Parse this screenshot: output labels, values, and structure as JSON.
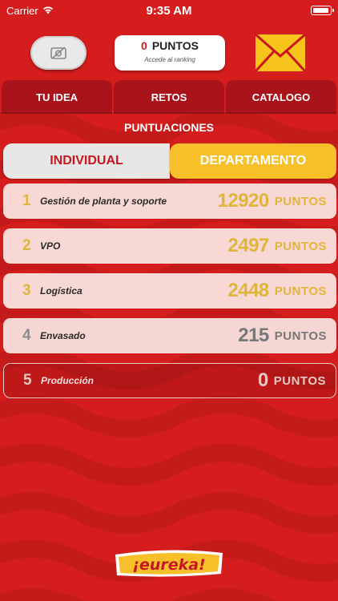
{
  "status_bar": {
    "carrier": "Carrier",
    "time": "9:35 AM"
  },
  "header": {
    "points_value": "0",
    "points_label": "PUNTOS",
    "points_subtitle": "Accede al ranking"
  },
  "nav": {
    "tabs": [
      "TU IDEA",
      "RETOS",
      "CATALOGO"
    ]
  },
  "section_title": "PUNTUACIONES",
  "segment": {
    "individual": "INDIVIDUAL",
    "department": "DEPARTAMENTO",
    "selected": "DEPARTAMENTO"
  },
  "ranking": [
    {
      "rank": "1",
      "name": "Gestión de planta y soporte",
      "score": "12920",
      "unit": "PUNTOS"
    },
    {
      "rank": "2",
      "name": "VPO",
      "score": "2497",
      "unit": "PUNTOS"
    },
    {
      "rank": "3",
      "name": "Logística",
      "score": "2448",
      "unit": "PUNTOS"
    },
    {
      "rank": "4",
      "name": "Envasado",
      "score": "215",
      "unit": "PUNTOS"
    },
    {
      "rank": "5",
      "name": "Producción",
      "score": "0",
      "unit": "PUNTOS"
    }
  ],
  "logo_text": "¡eureka!",
  "colors": {
    "brand_red": "#d61d1d",
    "gold": "#e0b53b",
    "yellow": "#f7c02a"
  }
}
